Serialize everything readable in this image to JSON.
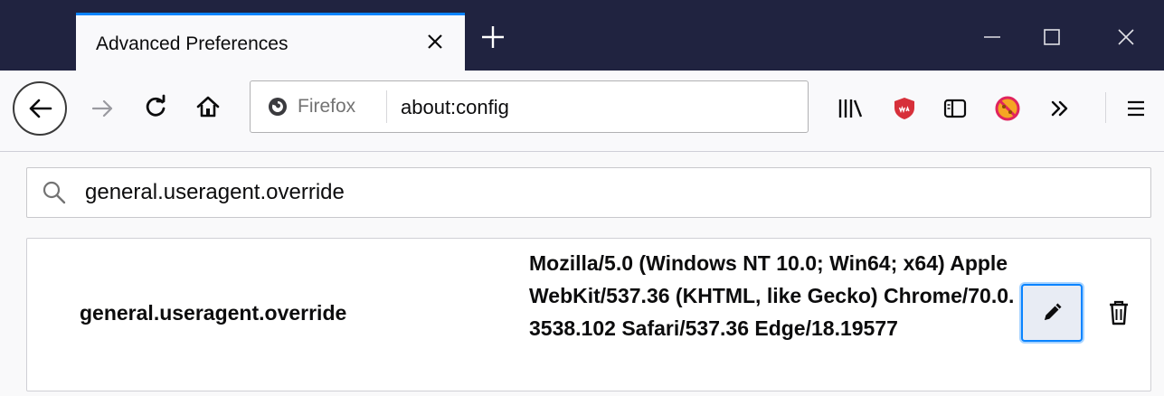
{
  "window": {
    "tab_title": "Advanced Preferences",
    "icons": {
      "close_tab": "close-icon",
      "new_tab": "plus-icon",
      "minimize": "minimize-icon",
      "maximize": "maximize-icon",
      "close_window": "close-icon"
    }
  },
  "toolbar": {
    "identity_label": "Firefox",
    "url": "about:config",
    "icons": [
      "back-icon",
      "forward-icon",
      "reload-icon",
      "home-icon",
      "firefox-logo-icon",
      "library-icon",
      "wab-shield-icon",
      "sidebar-icon",
      "blocked-extension-icon",
      "overflow-icon",
      "menu-icon"
    ]
  },
  "search": {
    "value": "general.useragent.override"
  },
  "preference": {
    "name": "general.useragent.override",
    "value": "Mozilla/5.0 (Windows NT 10.0; Win64; x64) AppleWebKit/537.36 (KHTML, like Gecko) Chrome/70.0.3538.102 Safari/537.36 Edge/18.19577",
    "icons": [
      "pencil-icon",
      "trash-icon"
    ]
  },
  "colors": {
    "titlebar": "#202340",
    "tab_accent": "#0a84ff",
    "toolbar": "#f9f9fb"
  }
}
